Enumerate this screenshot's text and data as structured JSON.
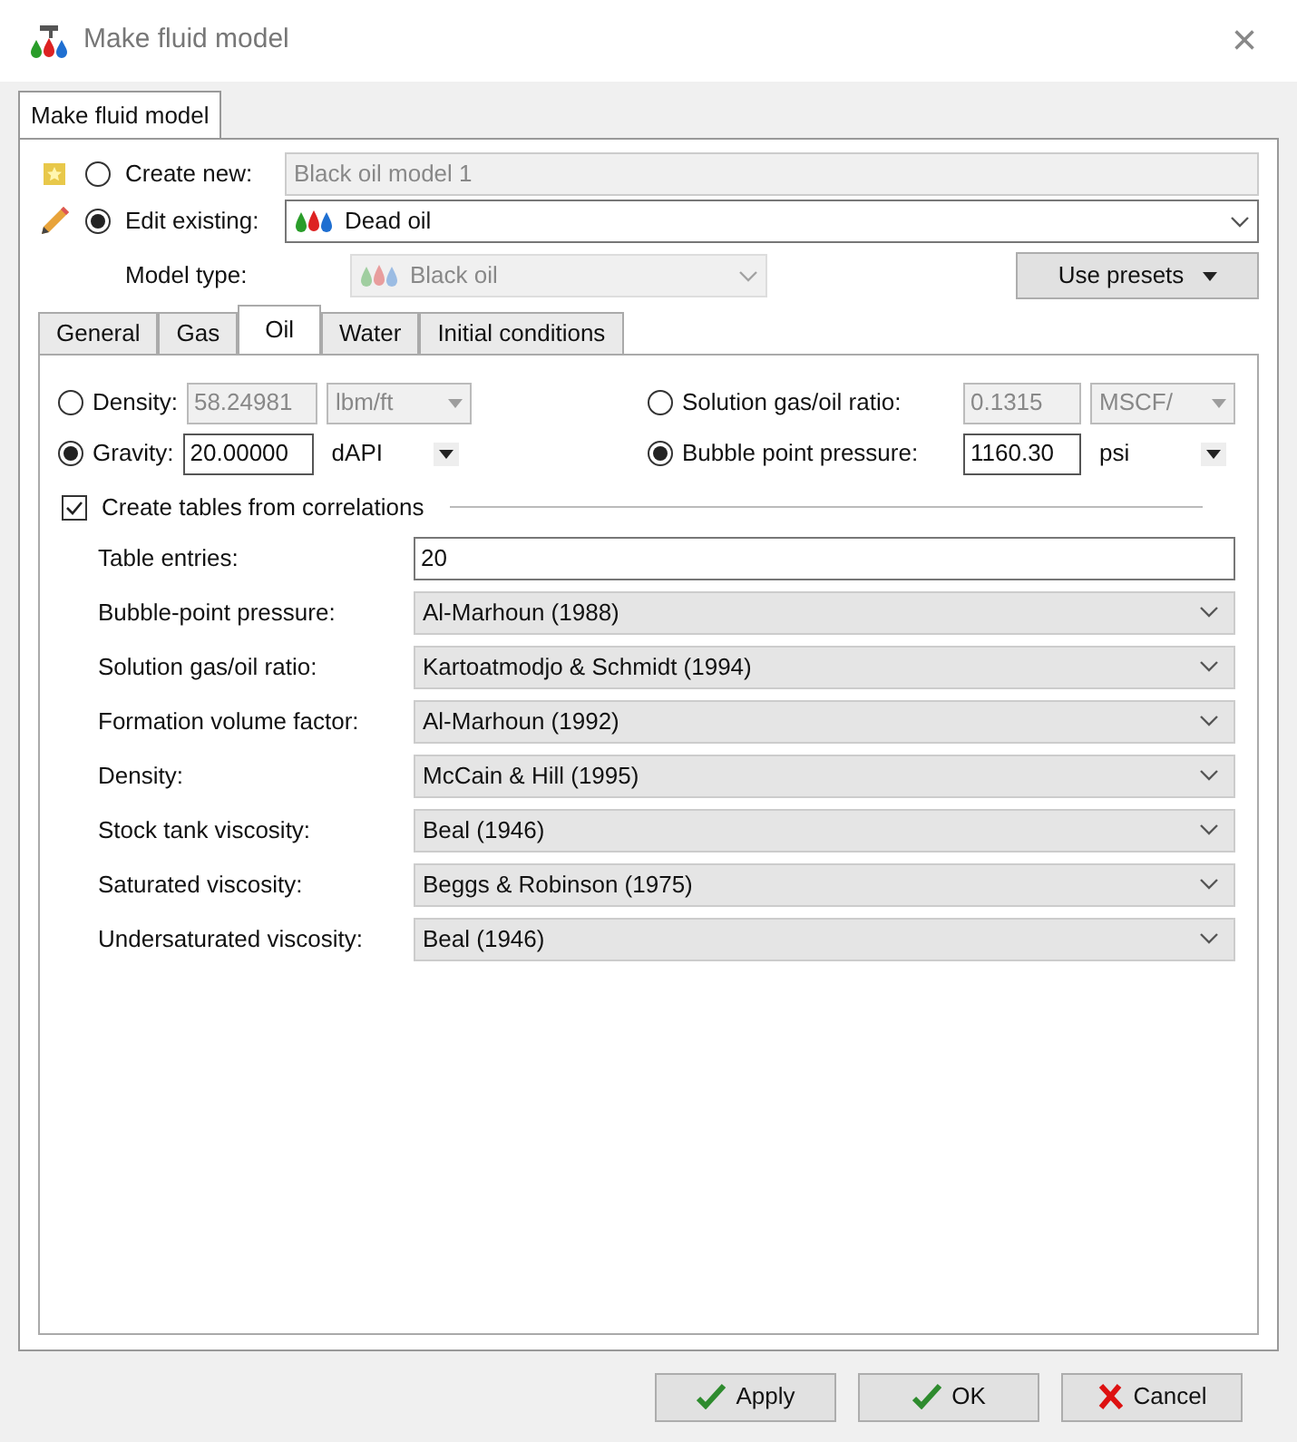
{
  "window": {
    "title": "Make fluid model",
    "close": "×"
  },
  "outer_tabs": [
    {
      "label": "Make fluid model",
      "selected": true
    }
  ],
  "source": [
    {
      "kind": "new",
      "label": "Create new:",
      "selected": false,
      "value": "Black oil model 1"
    },
    {
      "kind": "existing",
      "label": "Edit existing:",
      "selected": true,
      "value": "Dead oil"
    }
  ],
  "model_type": {
    "label": "Model type:",
    "value": "Black oil",
    "disabled": true
  },
  "use_presets": "Use presets",
  "tabs": [
    {
      "label": "General",
      "selected": false
    },
    {
      "label": "Gas",
      "selected": false
    },
    {
      "label": "Oil",
      "selected": true
    },
    {
      "label": "Water",
      "selected": false
    },
    {
      "label": "Initial conditions",
      "selected": false
    }
  ],
  "inputs_left": [
    {
      "label": "Density:",
      "selected": false,
      "value": "58.24981",
      "unit": "lbm/ft"
    },
    {
      "label": "Gravity:",
      "selected": true,
      "value": "20.00000",
      "unit": "dAPI"
    }
  ],
  "inputs_right": [
    {
      "label": "Solution gas/oil ratio:",
      "selected": false,
      "value": "0.1315",
      "unit": "MSCF/"
    },
    {
      "label": "Bubble point pressure:",
      "selected": true,
      "value": "1160.30",
      "unit": "psi"
    }
  ],
  "create_tables": {
    "label": "Create tables from correlations",
    "checked": true
  },
  "table_entries": {
    "label": "Table entries:",
    "value": "20"
  },
  "correlations": [
    {
      "label": "Bubble-point pressure:",
      "value": "Al-Marhoun (1988)"
    },
    {
      "label": "Solution gas/oil ratio:",
      "value": "Kartoatmodjo & Schmidt (1994)"
    },
    {
      "label": "Formation volume factor:",
      "value": "Al-Marhoun (1992)"
    },
    {
      "label": "Density:",
      "value": "McCain & Hill (1995)"
    },
    {
      "label": "Stock tank viscosity:",
      "value": "Beal (1946)"
    },
    {
      "label": "Saturated viscosity:",
      "value": "Beggs & Robinson (1975)"
    },
    {
      "label": "Undersaturated viscosity:",
      "value": "Beal (1946)"
    }
  ],
  "buttons": [
    {
      "kind": "check",
      "label": "Apply"
    },
    {
      "kind": "check",
      "label": "OK"
    },
    {
      "kind": "cross",
      "label": "Cancel"
    }
  ]
}
